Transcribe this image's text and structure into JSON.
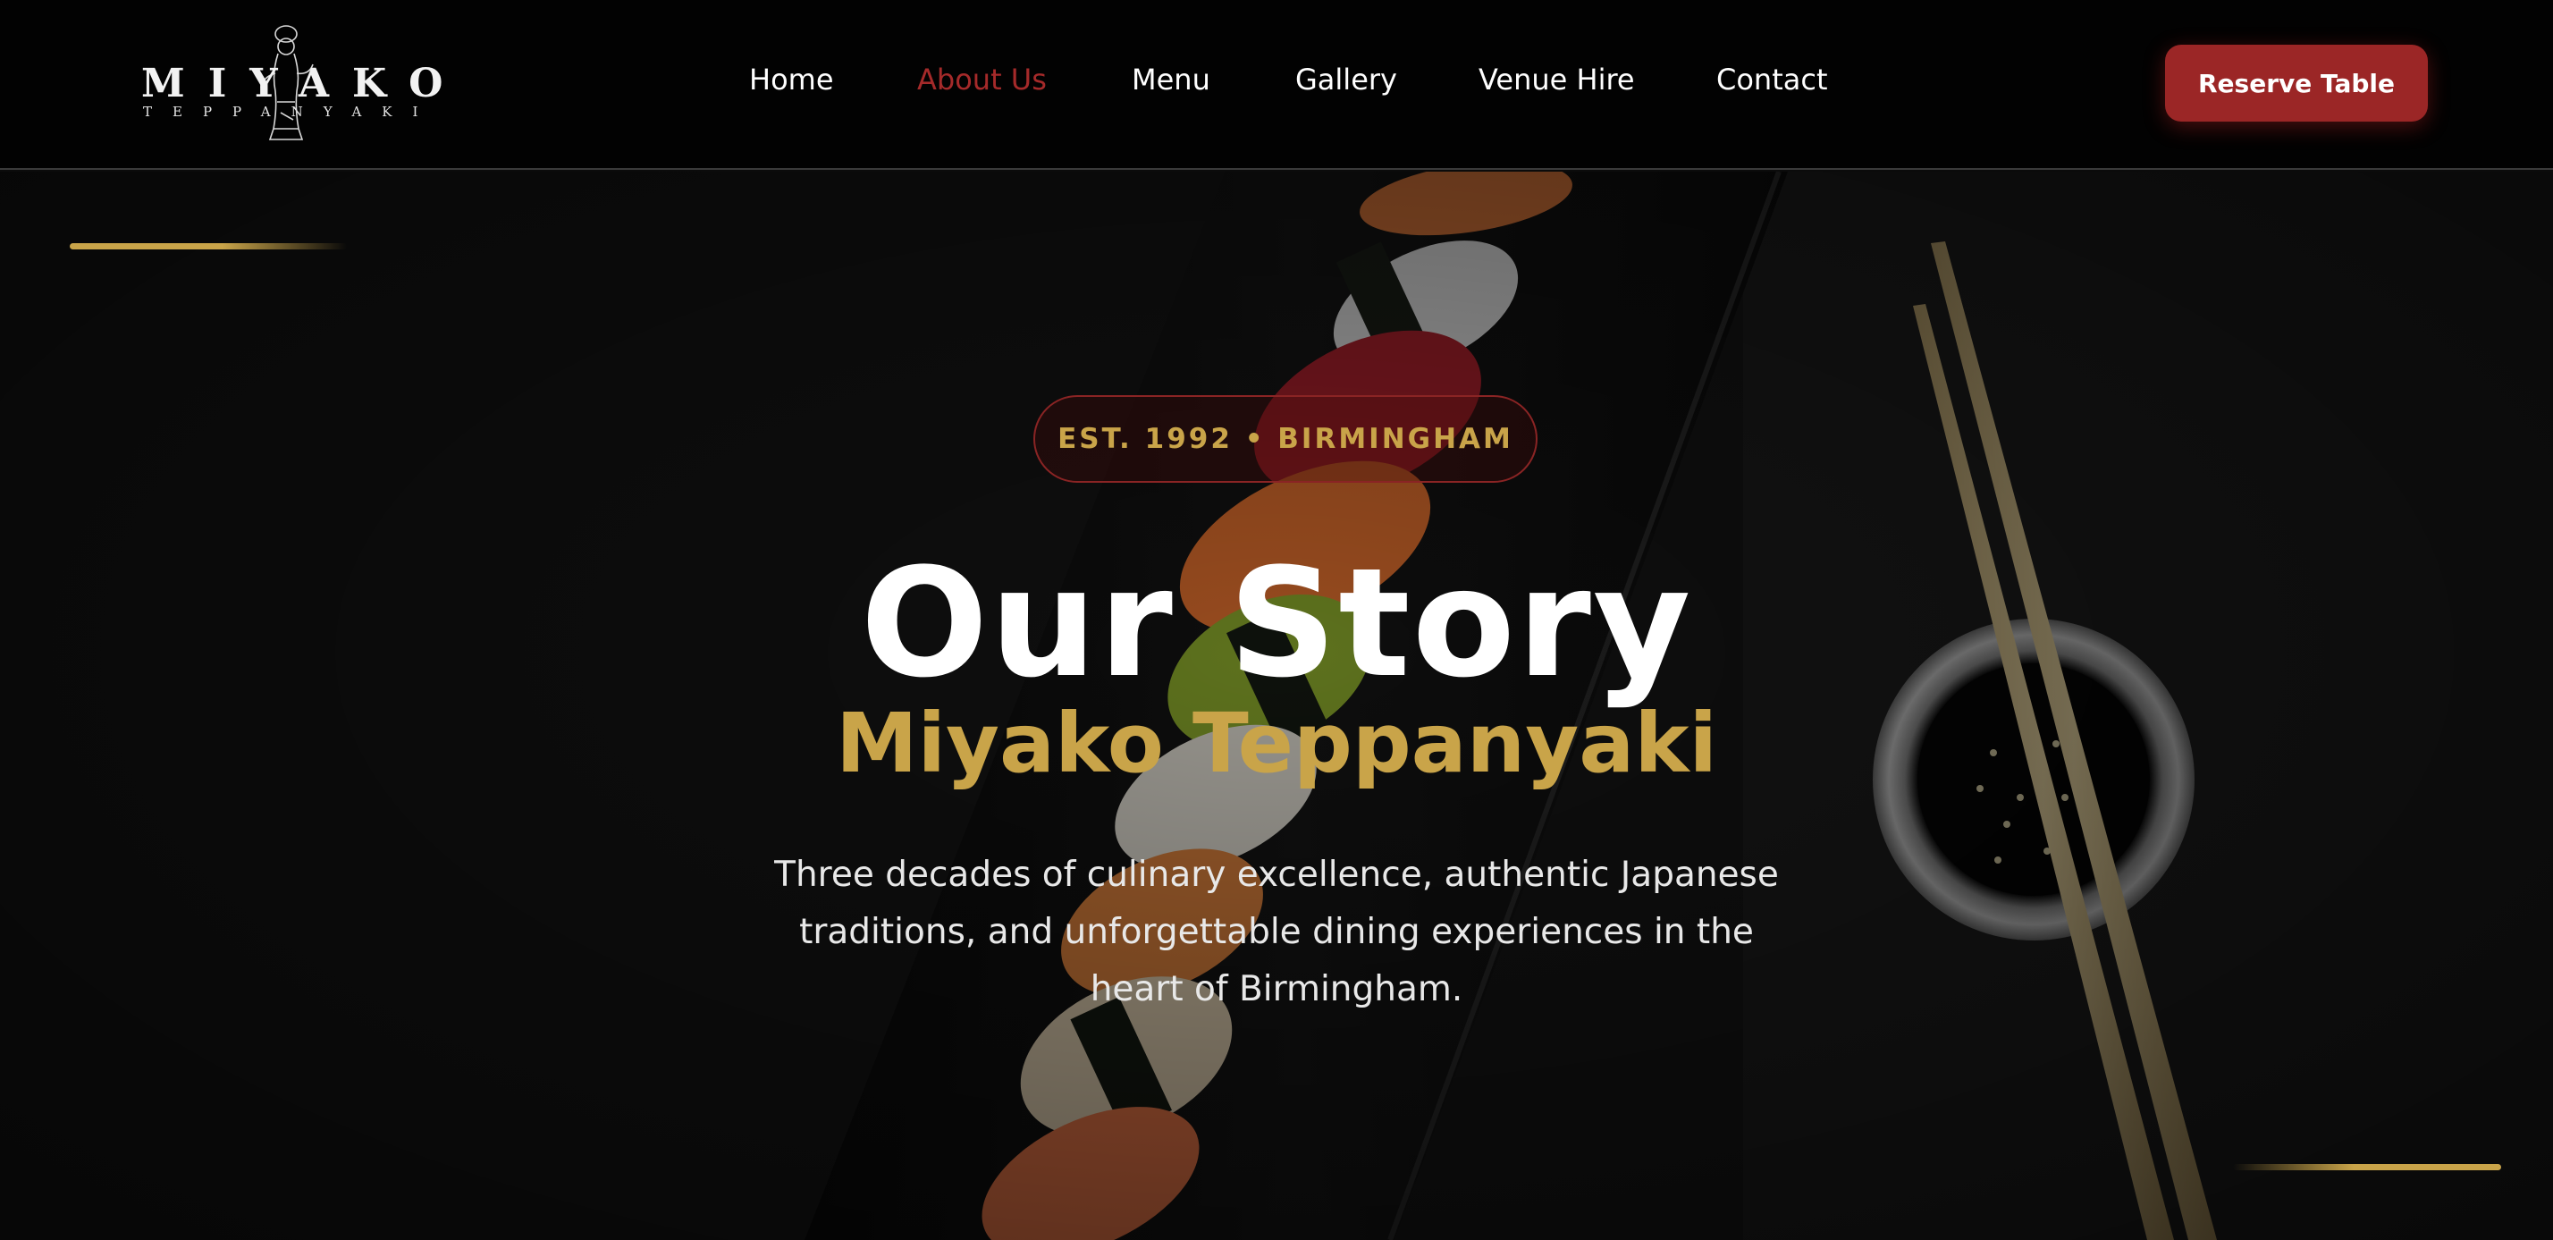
{
  "brand": {
    "name": "MIYAKO",
    "tagline": "TEPPANYAKI",
    "logo_icon": "geisha-figure-icon"
  },
  "nav": {
    "items": [
      {
        "label": "Home",
        "active": false
      },
      {
        "label": "About Us",
        "active": true
      },
      {
        "label": "Menu",
        "active": false
      },
      {
        "label": "Gallery",
        "active": false
      },
      {
        "label": "Venue Hire",
        "active": false
      },
      {
        "label": "Contact",
        "active": false
      }
    ],
    "cta_label": "Reserve Table"
  },
  "hero": {
    "badge": "EST. 1992 • BIRMINGHAM",
    "title": "Our Story",
    "subtitle": "Miyako Teppanyaki",
    "description": "Three decades of culinary excellence, authentic Japanese traditions, and unforgettable dining experiences in the heart of Birmingham.",
    "background_image": "sushi-platter-with-chopsticks-and-soy-sauce"
  },
  "colors": {
    "accent_red": "#9b2626",
    "active_nav": "#a52a2a",
    "gold": "#c9a449",
    "nav_bg": "#020202",
    "text": "#ffffff"
  }
}
